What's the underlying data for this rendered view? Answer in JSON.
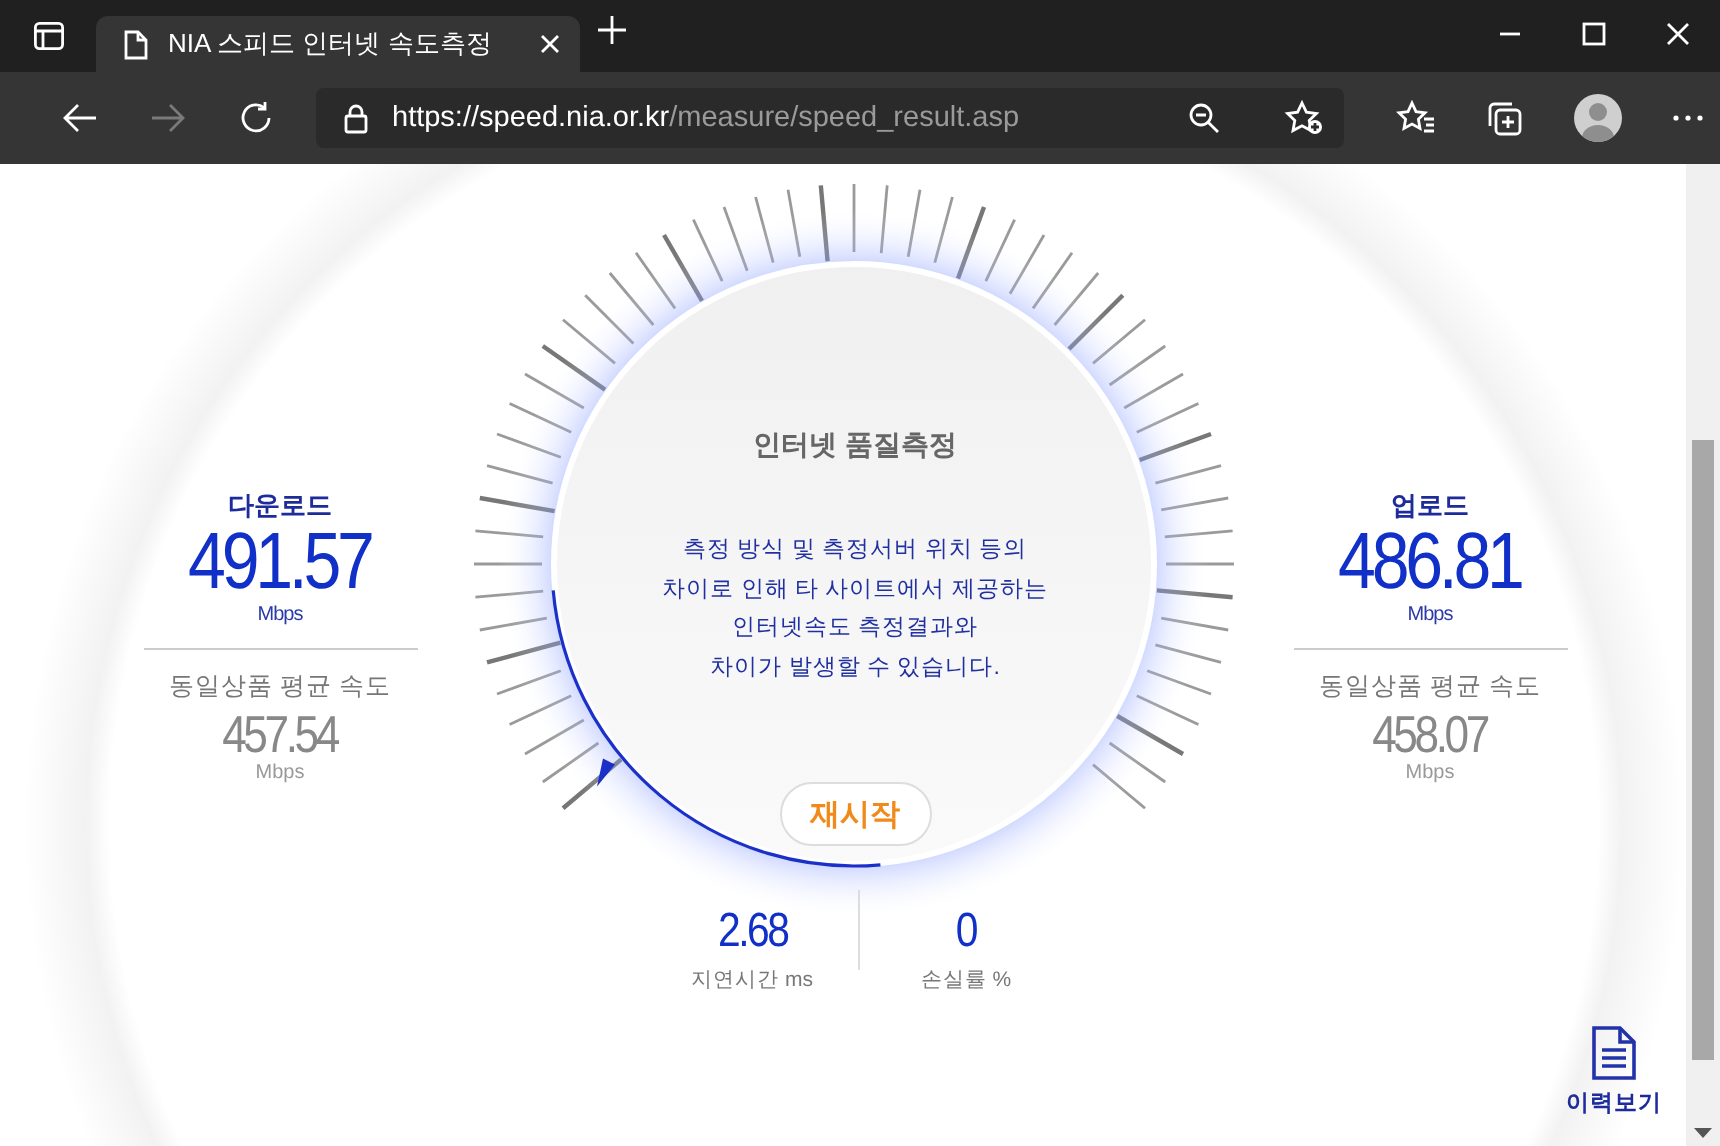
{
  "browser": {
    "tabs": [
      {
        "title": "NIA 스피드 인터넷 속도측정",
        "selected": true
      }
    ],
    "url": {
      "host": "https://speed.nia.or.kr",
      "path": "/measure/speed_result.asp"
    }
  },
  "download": {
    "label": "다운로드",
    "value": "491.57",
    "unit": "Mbps",
    "avg_label": "동일상품 평균 속도",
    "avg_value": "457.54",
    "avg_unit": "Mbps"
  },
  "upload": {
    "label": "업로드",
    "value": "486.81",
    "unit": "Mbps",
    "avg_label": "동일상품 평균 속도",
    "avg_value": "458.07",
    "avg_unit": "Mbps"
  },
  "gauge": {
    "title": "인터넷 품질측정",
    "notice": "측정 방식 및 측정서버 위치 등의\n차이로 인해 타 사이트에서 제공하는\n인터넷속도 측정결과와\n차이가 발생할 수 있습니다.",
    "restart_button": "재시작"
  },
  "metrics": [
    {
      "value": "2.68",
      "label": "지연시간",
      "unit": "ms"
    },
    {
      "value": "0",
      "label": "손실률",
      "unit": "%"
    }
  ],
  "history_link": "이력보기"
}
